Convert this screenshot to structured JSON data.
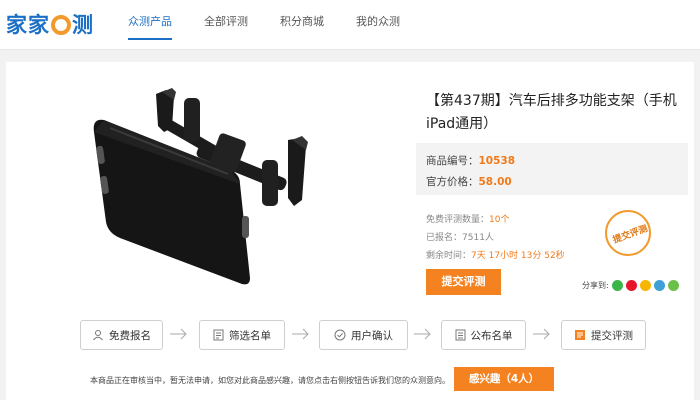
{
  "header": {
    "logo_text": "家家众测",
    "nav": [
      {
        "label": "众测产品",
        "active": true
      },
      {
        "label": "全部评测",
        "active": false
      },
      {
        "label": "积分商城",
        "active": false
      },
      {
        "label": "我的众测",
        "active": false
      }
    ]
  },
  "product": {
    "title": "【第437期】汽车后排多功能支架（手机iPad通用）",
    "image_icon": "car-headrest-tablet-holder",
    "code_label": "商品编号：",
    "code_value": "10538",
    "price_label": "官方价格：",
    "price_value": "58.00",
    "free_count_label": "免费评测数量：",
    "free_count_value": "10个",
    "registered_label": "已报名：",
    "registered_value": "7511人",
    "remaining_label": "剩余时间：",
    "remaining_value": "7天 17小时 13分 52秒",
    "apply_button": "提交评测",
    "stamp_text": "提交评测",
    "share_label": "分享到:",
    "share_icons": [
      {
        "name": "wechat-icon",
        "color": "#3bb44a"
      },
      {
        "name": "weibo-icon",
        "color": "#e6162d"
      },
      {
        "name": "qzone-icon",
        "color": "#f7b500"
      },
      {
        "name": "tencent-weibo-icon",
        "color": "#3fa0d8"
      },
      {
        "name": "more-share-icon",
        "color": "#6cc04a"
      }
    ]
  },
  "steps": [
    {
      "label": "免费报名",
      "icon": "user-icon"
    },
    {
      "label": "筛选名单",
      "icon": "list-doc-icon"
    },
    {
      "label": "用户确认",
      "icon": "check-circle-icon"
    },
    {
      "label": "公布名单",
      "icon": "announce-doc-icon"
    },
    {
      "label": "提交评测",
      "icon": "report-icon"
    }
  ],
  "footer": {
    "notice": "本商品正在审核当中，暂无法申请，如您对此商品感兴趣，请您点击右侧按钮告诉我们您的众测意向。",
    "interest_button": "感兴趣（4人）"
  },
  "colors": {
    "brand_blue": "#1b6fc4",
    "accent_orange": "#f58220"
  }
}
